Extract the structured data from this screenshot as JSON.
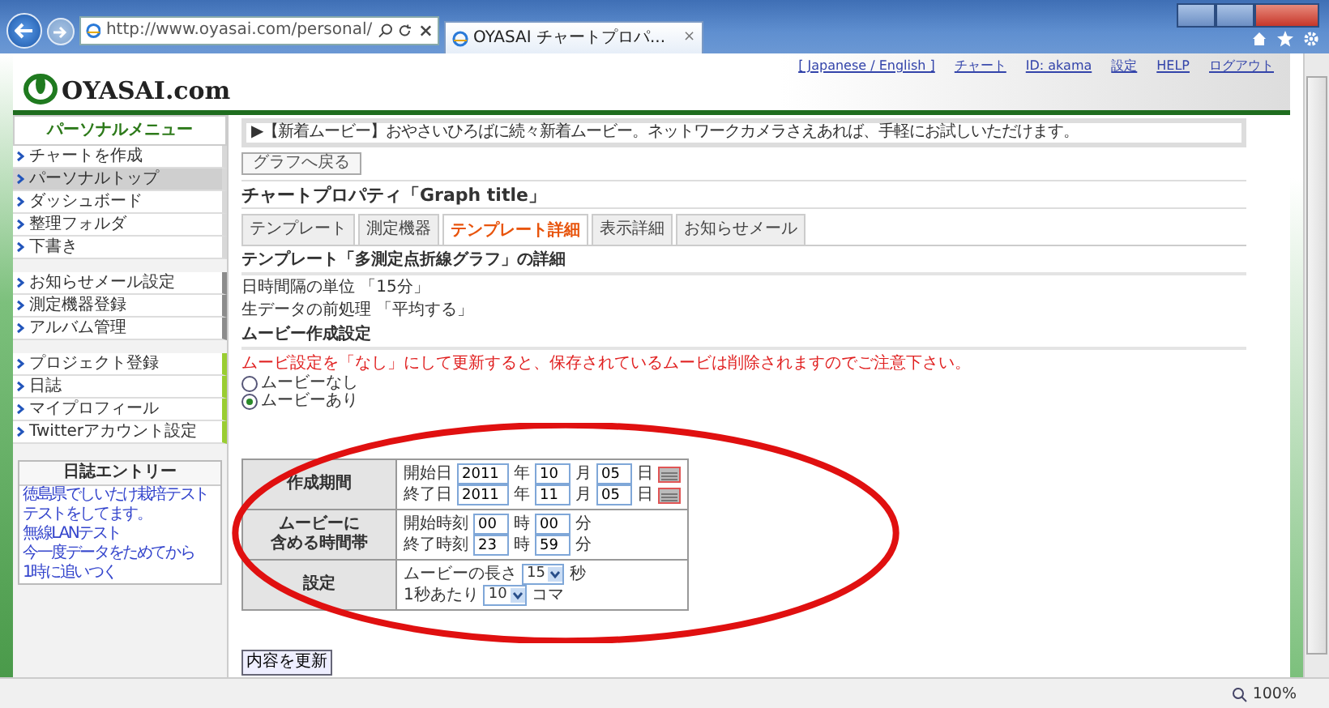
{
  "browser": {
    "url": "http://www.oyasai.com/personal/",
    "tab_title": "OYASAI チャートプロパ...",
    "tab_close": "×",
    "zoom": "100%"
  },
  "header": {
    "logo": "OYASAI.com",
    "links": [
      "[ Japanese / English ]",
      "チャート",
      "ID: akama",
      "設定",
      "HELP",
      "ログアウト"
    ]
  },
  "sidebar": {
    "title": "パーソナルメニュー",
    "groups": [
      {
        "color": "#d8d8d8",
        "items": [
          {
            "label": "チャートを作成",
            "selected": false
          },
          {
            "label": "パーソナルトップ",
            "selected": true
          },
          {
            "label": "ダッシュボード",
            "selected": false
          },
          {
            "label": "整理フォルダ",
            "selected": false
          },
          {
            "label": "下書き",
            "selected": false
          }
        ]
      },
      {
        "color": "#8c8c8c",
        "items": [
          {
            "label": "お知らせメール設定",
            "selected": false
          },
          {
            "label": "測定機器登録",
            "selected": false
          },
          {
            "label": "アルバム管理",
            "selected": false
          }
        ]
      },
      {
        "color": "#9acd32",
        "items": [
          {
            "label": "プロジェクト登録",
            "selected": false
          },
          {
            "label": "日誌",
            "selected": false
          },
          {
            "label": "マイプロフィール",
            "selected": false
          },
          {
            "label": "Twitterアカウント設定",
            "selected": false
          }
        ]
      }
    ],
    "diary": {
      "title": "日誌エントリー",
      "entries": [
        "徳島県でしいたけ栽培テスト",
        "テストをしてます。",
        "無線LANテスト",
        "今一度データをためてから",
        "1時に追いつく"
      ]
    }
  },
  "news": "▶【新着ムービー】おやさいひろばに続々新着ムービー。ネットワークカメラさえあれば、手軽にお試しいただけます。",
  "back_button": "グラフへ戻る",
  "page_title": "チャートプロパティ「Graph title」",
  "tabs": [
    {
      "label": "テンプレート",
      "selected": false
    },
    {
      "label": "測定機器",
      "selected": false
    },
    {
      "label": "テンプレート詳細",
      "selected": true
    },
    {
      "label": "表示詳細",
      "selected": false
    },
    {
      "label": "お知らせメール",
      "selected": false
    }
  ],
  "section_title": "テンプレート「多測定点折線グラフ」の詳細",
  "details": [
    "日時間隔の単位 「15分」",
    "生データの前処理 「平均する」"
  ],
  "movie_title": "ムービー作成設定",
  "warning": "ムービ設定を「なし」にして更新すると、保存されているムービは削除されますのでご注意下さい。",
  "radios": [
    {
      "label": "ムービーなし",
      "selected": false
    },
    {
      "label": "ムービーあり",
      "selected": true
    }
  ],
  "table": [
    {
      "header": [
        "作成期間"
      ],
      "lines": [
        [
          {
            "kind": "label",
            "text": "開始日"
          },
          {
            "kind": "input",
            "text": "2011"
          },
          {
            "kind": "unit",
            "text": "年"
          },
          {
            "kind": "input",
            "text": "10"
          },
          {
            "kind": "unit",
            "text": "月"
          },
          {
            "kind": "input",
            "text": "05"
          },
          {
            "kind": "unit",
            "text": "日"
          },
          {
            "kind": "calendar"
          }
        ],
        [
          {
            "kind": "label",
            "text": "終了日"
          },
          {
            "kind": "input",
            "text": "2011"
          },
          {
            "kind": "unit",
            "text": "年"
          },
          {
            "kind": "input",
            "text": "11"
          },
          {
            "kind": "unit",
            "text": "月"
          },
          {
            "kind": "input",
            "text": "05"
          },
          {
            "kind": "unit",
            "text": "日"
          },
          {
            "kind": "calendar"
          }
        ]
      ]
    },
    {
      "header": [
        "ムービーに",
        "含める時間帯"
      ],
      "lines": [
        [
          {
            "kind": "label",
            "text": "開始時刻"
          },
          {
            "kind": "input",
            "text": "00"
          },
          {
            "kind": "unit",
            "text": "時"
          },
          {
            "kind": "input",
            "text": "00"
          },
          {
            "kind": "unit",
            "text": "分"
          }
        ],
        [
          {
            "kind": "label",
            "text": "終了時刻"
          },
          {
            "kind": "input",
            "text": "23"
          },
          {
            "kind": "unit",
            "text": "時"
          },
          {
            "kind": "input",
            "text": "59"
          },
          {
            "kind": "unit",
            "text": "分"
          }
        ]
      ]
    },
    {
      "header": [
        "設定"
      ],
      "lines": [
        [
          {
            "kind": "label",
            "text": "ムービーの長さ"
          },
          {
            "kind": "select",
            "text": "15"
          },
          {
            "kind": "unit",
            "text": "秒"
          }
        ],
        [
          {
            "kind": "label",
            "text": "1秒あたり"
          },
          {
            "kind": "select",
            "text": "10"
          },
          {
            "kind": "unit",
            "text": "コマ"
          }
        ]
      ]
    }
  ],
  "submit_button": "内容を更新"
}
